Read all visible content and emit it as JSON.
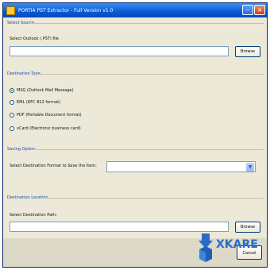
{
  "window": {
    "title": "PORTIA PST Extractor - Full Version v1.0"
  },
  "source": {
    "section_label": "Select Source",
    "file_label": "Select Outlook (.PST) file",
    "file_value": "",
    "browse_label": "Browse"
  },
  "destination_type": {
    "section_label": "Destination Type",
    "options": [
      {
        "label": "MSG (Outlook Mail Message)",
        "selected": true
      },
      {
        "label": "EML (RFC 822 format)",
        "selected": false
      },
      {
        "label": "PDF (Portable Document format)",
        "selected": false
      },
      {
        "label": "vCard (Electronic business card)",
        "selected": false
      }
    ]
  },
  "saving_option": {
    "section_label": "Saving Option",
    "format_label": "Select Destination Format to Save the Item:",
    "format_value": ""
  },
  "destination_location": {
    "section_label": "Destination Location",
    "path_label": "Select Destination Path:",
    "path_value": "",
    "browse_label": "Browse"
  },
  "footer": {
    "cancel_label": "Cancel"
  },
  "watermark": {
    "brand": "XKARE",
    "brand_color": "#2a6bc8"
  }
}
